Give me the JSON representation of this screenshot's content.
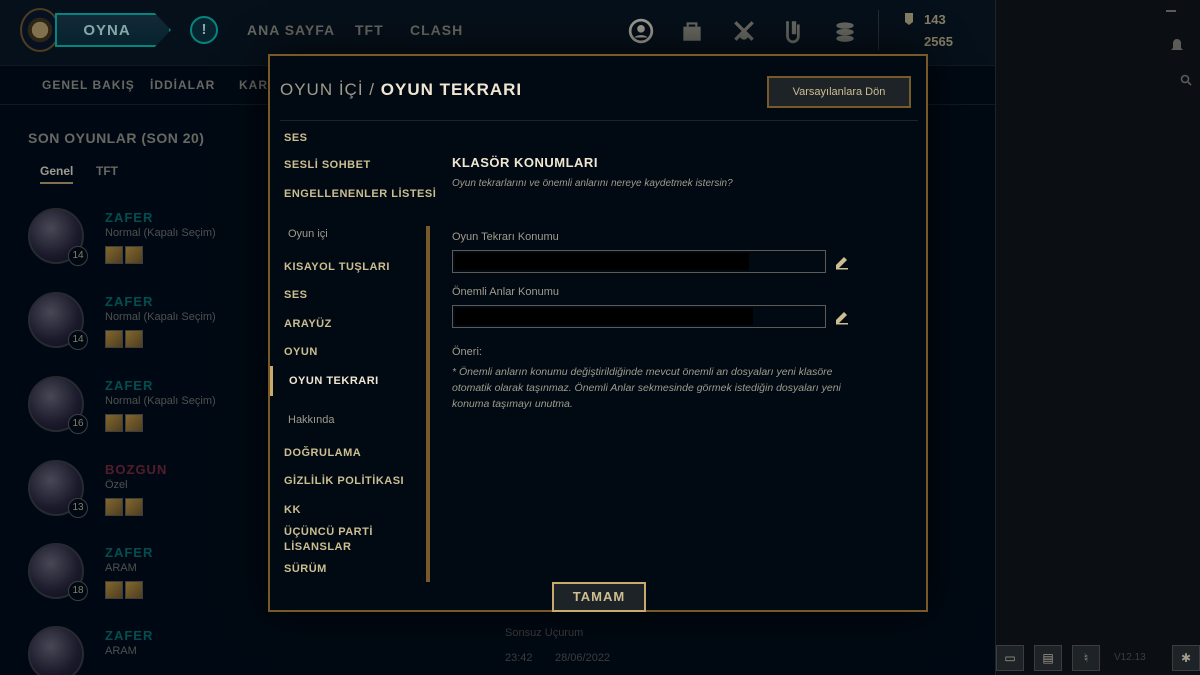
{
  "topbar": {
    "play_label": "OYNA",
    "alert_label": "!",
    "nav": [
      "ANA SAYFA",
      "TFT",
      "CLASH"
    ],
    "icons": [
      "profile-icon",
      "collection-icon",
      "loot-icon",
      "clash-icon",
      "store-icon"
    ],
    "currency_rp": "143",
    "currency_be": "2565"
  },
  "subnav": [
    "GENEL BAKIŞ",
    "İDDİALAR",
    "KARŞ"
  ],
  "sidebar": {
    "title": "SON OYUNLAR (SON 20)",
    "tabs": [
      "Genel",
      "TFT"
    ]
  },
  "matches": [
    {
      "result": "ZAFER",
      "mode": "Normal (Kapalı Seçim)",
      "level": "14"
    },
    {
      "result": "ZAFER",
      "mode": "Normal (Kapalı Seçim)",
      "level": "14"
    },
    {
      "result": "ZAFER",
      "mode": "Normal (Kapalı Seçim)",
      "level": "16"
    },
    {
      "result": "BOZGUN",
      "mode": "Özel",
      "level": "13"
    },
    {
      "result": "ZAFER",
      "mode": "ARAM",
      "level": "18"
    },
    {
      "result": "ZAFER",
      "mode": "ARAM",
      "level": ""
    }
  ],
  "bottom_match": {
    "map": "Sonsuz Uçurum",
    "time": "23:42",
    "date": "28/06/2022"
  },
  "version": "V12.13",
  "modal": {
    "breadcrumb_prefix": "OYUN İÇİ",
    "breadcrumb_sep": "/",
    "breadcrumb_current": "OYUN TEKRARI",
    "reset_label": "Varsayılanlara Dön",
    "menu": {
      "ses_top": "SES",
      "sesli_sohbet": "SESLİ SOHBET",
      "engellenenler": "ENGELLENENLER LİSTESİ",
      "group_oyun_ici": "Oyun içi",
      "kisayol": "KISAYOL TUŞLARI",
      "ses": "SES",
      "arayuz": "ARAYÜZ",
      "oyun": "OYUN",
      "oyun_tekrari": "OYUN TEKRARI",
      "group_hakkinda": "Hakkında",
      "dogrulama": "DOĞRULAMA",
      "gizlilik": "GİZLİLİK POLİTİKASI",
      "kk": "KK",
      "ucuncu_parti": "ÜÇÜNCÜ PARTİ LİSANSLAR",
      "surum": "SÜRÜM"
    },
    "section_title": "KLASÖR KONUMLARI",
    "section_desc": "Oyun tekrarlarını ve önemli anlarını nereye kaydetmek istersin?",
    "replay_label": "Oyun Tekrarı Konumu",
    "highlights_label": "Önemli Anlar Konumu",
    "note_label": "Öneri:",
    "note_text": "* Önemli anların konumu değiştirildiğinde mevcut önemli an dosyaları yeni klasöre otomatik olarak taşınmaz. Önemli Anlar sekmesinde görmek istediğin dosyaları yeni konuma taşımayı unutma.",
    "ok_label": "TAMAM"
  },
  "colors": {
    "gold": "#c8aa6e",
    "gold_dark": "#785a28",
    "teal": "#0ac8b9",
    "loss": "#e84057"
  }
}
